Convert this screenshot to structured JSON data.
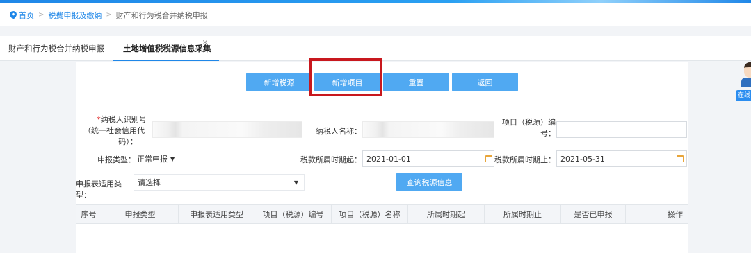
{
  "breadcrumb": {
    "home": "首页",
    "level2": "税费申报及缴纳",
    "current": "财产和行为税合并纳税申报",
    "separator": ">"
  },
  "tabs": [
    {
      "label": "财产和行为税合并纳税申报",
      "active": false
    },
    {
      "label": "土地增值税税源信息采集",
      "active": true,
      "close": "×"
    }
  ],
  "toolbar": {
    "add_tax_source": "新增税源",
    "add_project": "新增项目",
    "reset": "重置",
    "back": "返回"
  },
  "form": {
    "required_mark": "*",
    "taxpayer_id_label_1": "纳税人识别号",
    "taxpayer_id_label_2": "（统一社会信用代",
    "taxpayer_id_label_3": "码）：",
    "taxpayer_name_label": "纳税人名称：",
    "project_no_label_1": "项目（税源）编",
    "project_no_label_2": "号：",
    "declare_type_label": "申报类型：",
    "declare_type_value": "正常申报",
    "period_start_label": "税款所属时期起：",
    "period_start_value": "2021-01-01",
    "period_end_label": "税款所属时期止：",
    "period_end_value": "2021-05-31",
    "form_type_label": "申报表适用类型：",
    "form_type_value": "请选择",
    "query_button": "查询税源信息"
  },
  "table": {
    "columns": [
      "序号",
      "申报类型",
      "申报表适用类型",
      "项目（税源）编号",
      "项目（税源）名称",
      "所属时期起",
      "所属时期止",
      "是否已申报",
      "操作"
    ]
  },
  "side_widget": {
    "label": "在线"
  },
  "colors": {
    "accent": "#1f87e8",
    "button": "#50a9f2",
    "highlight": "#c8181e",
    "calendar": "#e8a53a"
  }
}
